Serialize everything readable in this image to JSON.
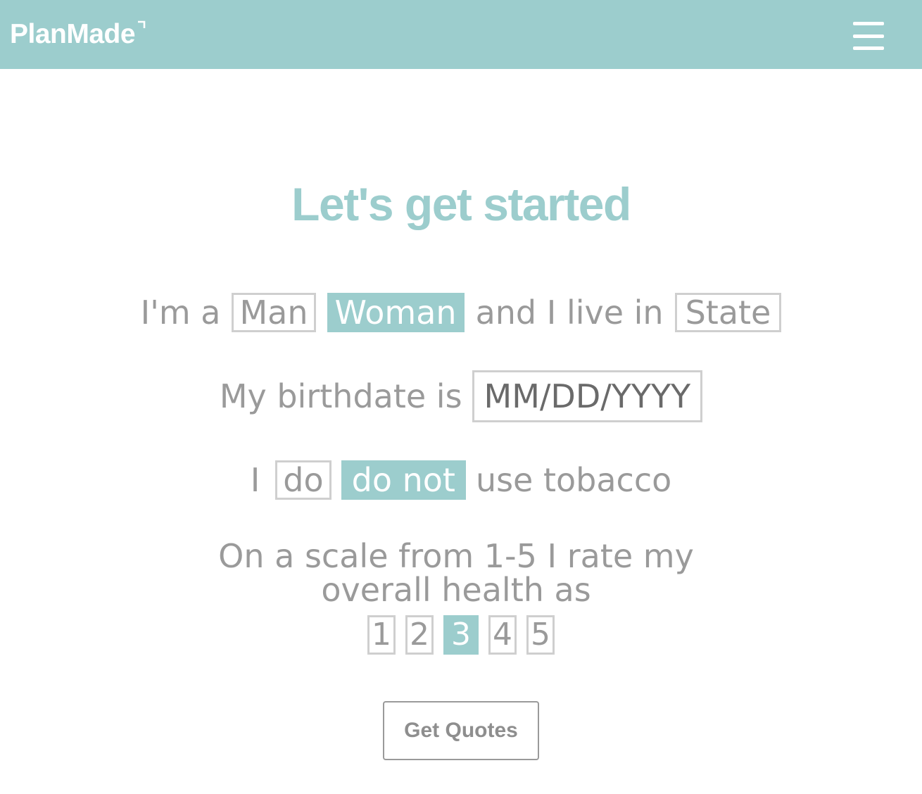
{
  "header": {
    "logo_text": "PlanMade",
    "menu_icon": "hamburger-menu-icon",
    "background": "#9ccdcd"
  },
  "main": {
    "title": "Let's get started",
    "gender_row": {
      "prefix": "I'm a",
      "options": [
        "Man",
        "Woman"
      ],
      "selected": "Woman",
      "middle": "and I live in",
      "state_placeholder": "State"
    },
    "birthdate_row": {
      "prefix": "My birthdate is",
      "placeholder": "MM/DD/YYYY"
    },
    "tobacco_row": {
      "prefix": "I",
      "options": [
        "do",
        "do not"
      ],
      "selected": "do not",
      "suffix": "use tobacco"
    },
    "health_scale": {
      "text": "On a scale from 1-5 I rate my overall health as",
      "options": [
        "1",
        "2",
        "3",
        "4",
        "5"
      ],
      "selected": "3"
    },
    "submit_label": "Get Quotes"
  },
  "colors": {
    "accent": "#9ccdcd",
    "text": "#9a9a9a",
    "border": "#cfcfcf"
  }
}
